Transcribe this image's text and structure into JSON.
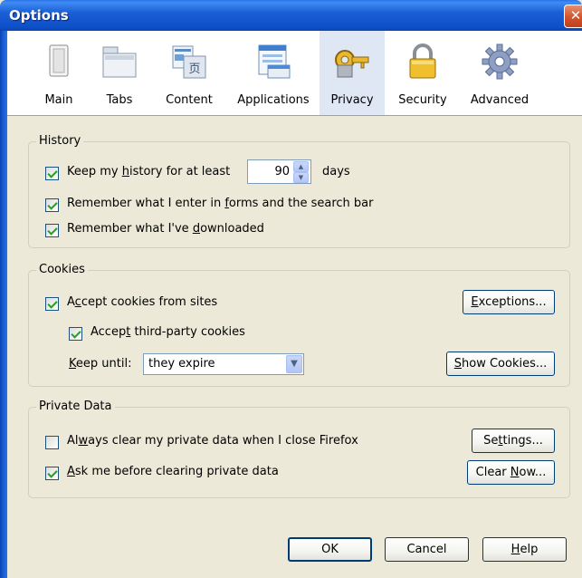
{
  "window": {
    "title": "Options",
    "close_glyph": "✕"
  },
  "toolbar": {
    "tabs": [
      {
        "label": "Main",
        "icon": "main-icon"
      },
      {
        "label": "Tabs",
        "icon": "tabs-icon"
      },
      {
        "label": "Content",
        "icon": "content-icon"
      },
      {
        "label": "Applications",
        "icon": "applications-icon"
      },
      {
        "label": "Privacy",
        "icon": "privacy-icon",
        "selected": true
      },
      {
        "label": "Security",
        "icon": "lock-icon"
      },
      {
        "label": "Advanced",
        "icon": "gear-icon"
      }
    ],
    "content_glyph": "页"
  },
  "history": {
    "title": "History",
    "keep_history": {
      "pre": "Keep my ",
      "u": "h",
      "post": "istory for at least",
      "checked": true
    },
    "days_value": "90",
    "days_label": "days",
    "remember_forms": {
      "pre": "Remember what I enter in ",
      "u": "f",
      "post": "orms and the search bar",
      "checked": true
    },
    "remember_downloads": {
      "pre": "Remember what I've ",
      "u": "d",
      "post": "ownloaded",
      "checked": true
    }
  },
  "cookies": {
    "title": "Cookies",
    "accept_cookies": {
      "pre": "A",
      "u": "c",
      "post": "cept cookies from sites",
      "checked": true
    },
    "accept_third_party": {
      "pre": "Accep",
      "u": "t",
      "post": " third-party cookies",
      "checked": true
    },
    "keep_until": {
      "pre": "",
      "u": "K",
      "post": "eep until:"
    },
    "keep_until_value": "they expire",
    "exceptions_button": {
      "pre": "",
      "u": "E",
      "post": "xceptions..."
    },
    "show_cookies_button": {
      "pre": "",
      "u": "S",
      "post": "how Cookies..."
    }
  },
  "private_data": {
    "title": "Private Data",
    "always_clear": {
      "pre": "Al",
      "u": "w",
      "post": "ays clear my private data when I close Firefox",
      "checked": false
    },
    "ask_before": {
      "pre": "",
      "u": "A",
      "post": "sk me before clearing private data",
      "checked": true
    },
    "settings_button": {
      "pre": "Se",
      "u": "t",
      "post": "tings..."
    },
    "clear_now_button": {
      "pre": "Clear ",
      "u": "N",
      "post": "ow..."
    }
  },
  "footer": {
    "ok_label": "OK",
    "cancel_label": "Cancel",
    "help_button": {
      "pre": "",
      "u": "H",
      "post": "elp"
    }
  }
}
